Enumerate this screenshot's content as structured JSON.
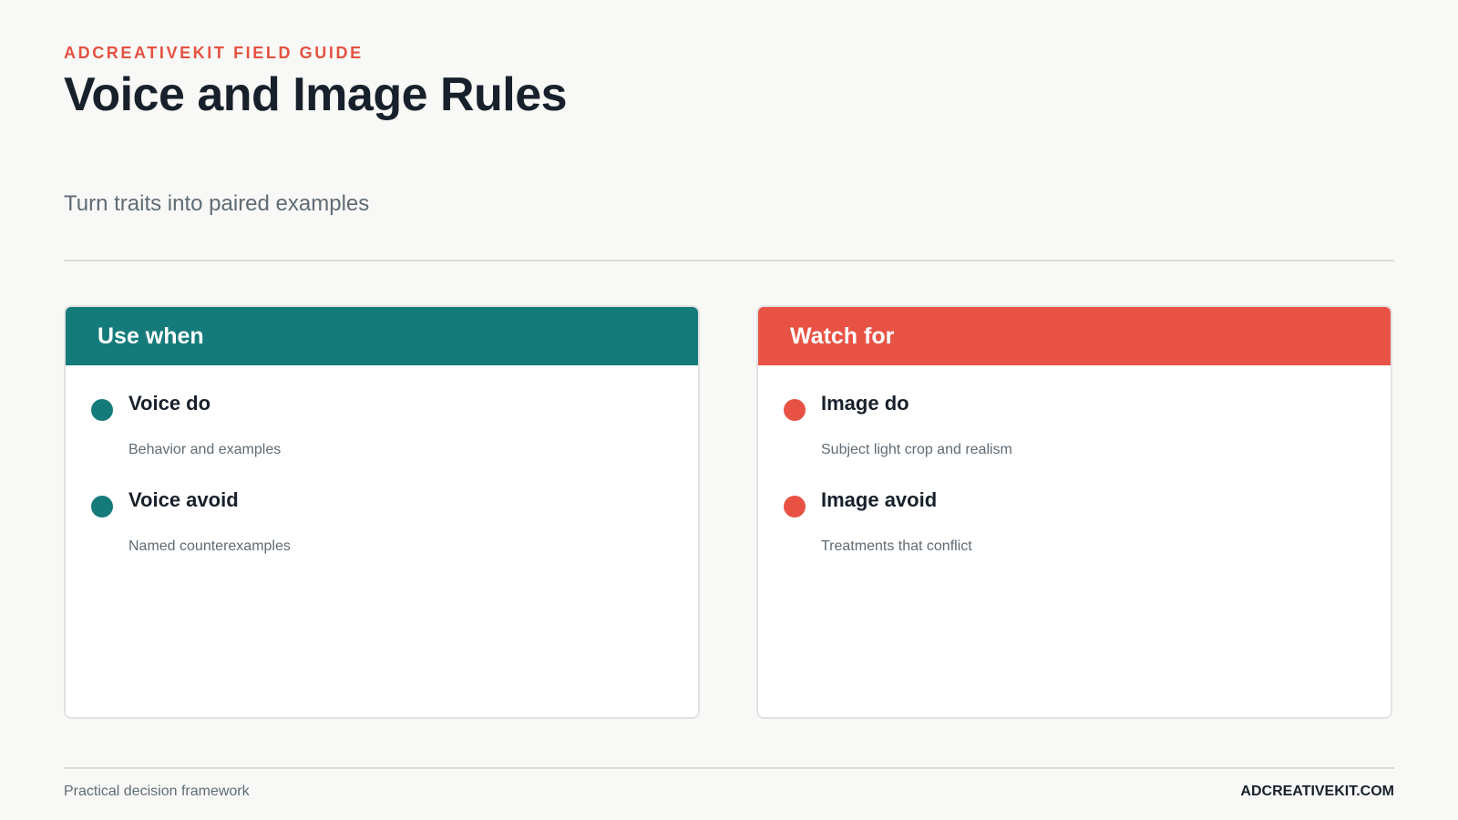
{
  "header": {
    "eyebrow": "ADCREATIVEKIT FIELD GUIDE",
    "title": "Voice and Image Rules",
    "subtitle": "Turn traits into paired examples"
  },
  "panels": [
    {
      "title": "Use when",
      "accent": "#157b7a",
      "items": [
        {
          "title": "Voice do",
          "description": "Behavior and examples"
        },
        {
          "title": "Voice avoid",
          "description": "Named counterexamples"
        }
      ]
    },
    {
      "title": "Watch for",
      "accent": "#e85245",
      "items": [
        {
          "title": "Image do",
          "description": "Subject light crop and realism"
        },
        {
          "title": "Image avoid",
          "description": "Treatments that conflict"
        }
      ]
    }
  ],
  "footer": {
    "left": "Practical decision framework",
    "right": "ADCREATIVEKIT.COM"
  },
  "colors": {
    "background": "#f8f8f6",
    "text": "#18212b",
    "muted": "#5f6b74",
    "eyebrow": "#e45242"
  }
}
